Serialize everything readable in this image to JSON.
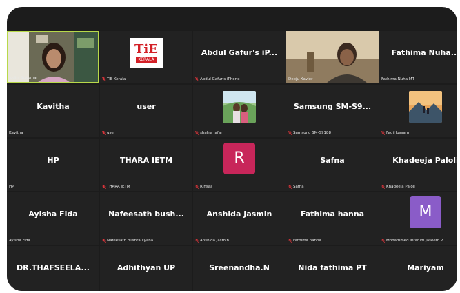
{
  "colors": {
    "frame_bg": "#1c1c1c",
    "tile_bg": "#222222",
    "active_border": "#b8d94a",
    "mic_muted": "#d9343a",
    "avatar_red": "#c8265a",
    "avatar_purple": "#8a5cc8"
  },
  "participants": [
    {
      "display": "",
      "label": "odini Sukumar",
      "muted": false,
      "kind": "video",
      "active": true
    },
    {
      "display": "",
      "label": "TiE Kerala",
      "muted": true,
      "kind": "logo",
      "logo_text": "TiE",
      "logo_sub": "KERALA"
    },
    {
      "display": "Abdul Gafur's iP...",
      "label": "Abdul Gafur's iPhone",
      "muted": true,
      "kind": "name"
    },
    {
      "display": "",
      "label": "Deeju Xavier",
      "muted": false,
      "kind": "video2"
    },
    {
      "display": "Fathima  Nuha...",
      "label": "Fathima Nuha MT",
      "muted": false,
      "kind": "name"
    },
    {
      "display": "Kavitha",
      "label": "Kavitha",
      "muted": false,
      "kind": "name"
    },
    {
      "display": "user",
      "label": "user",
      "muted": true,
      "kind": "name"
    },
    {
      "display": "",
      "label": "shalna Jafar",
      "muted": true,
      "kind": "photo1"
    },
    {
      "display": "Samsung  SM-S9...",
      "label": "Samsung SM-S9188",
      "muted": true,
      "kind": "name"
    },
    {
      "display": "",
      "label": "FadiHussam",
      "muted": true,
      "kind": "photo2"
    },
    {
      "display": "HP",
      "label": "HP",
      "muted": false,
      "kind": "name"
    },
    {
      "display": "THARA IETM",
      "label": "THARA IETM",
      "muted": true,
      "kind": "name"
    },
    {
      "display": "",
      "label": "Rinsaa",
      "muted": true,
      "kind": "avatar",
      "letter": "R",
      "color": "#c8265a"
    },
    {
      "display": "Safna",
      "label": "Safna",
      "muted": true,
      "kind": "name"
    },
    {
      "display": "Khadeeja Paloli",
      "label": "Khadeeja Paloli",
      "muted": true,
      "kind": "name"
    },
    {
      "display": "Ayisha Fida",
      "label": "Ayisha Fida",
      "muted": false,
      "kind": "name"
    },
    {
      "display": "Nafeesath  bush...",
      "label": "Nafeesath bushra liyana",
      "muted": true,
      "kind": "name"
    },
    {
      "display": "Anshida Jasmin",
      "label": "Anshida Jasmin",
      "muted": true,
      "kind": "name"
    },
    {
      "display": "Fathima hanna",
      "label": "Fathima hanna",
      "muted": true,
      "kind": "name"
    },
    {
      "display": "",
      "label": "Mohammed Ibrahim Jaseem P",
      "muted": true,
      "kind": "avatar",
      "letter": "M",
      "color": "#8a5cc8"
    },
    {
      "display": "DR.THAFSEELA...",
      "label": "AFSEELA KOYA",
      "muted": false,
      "kind": "name"
    },
    {
      "display": "Adhithyan UP",
      "label": "Adhithyan UP",
      "muted": true,
      "kind": "name"
    },
    {
      "display": "Sreenandha.N",
      "label": "Sreenandha.N",
      "muted": true,
      "kind": "name"
    },
    {
      "display": "Nida fathima PT",
      "label": "Nida fathima PT",
      "muted": true,
      "kind": "name"
    },
    {
      "display": "Mariyam",
      "label": "Mariyam",
      "muted": true,
      "kind": "name"
    }
  ]
}
